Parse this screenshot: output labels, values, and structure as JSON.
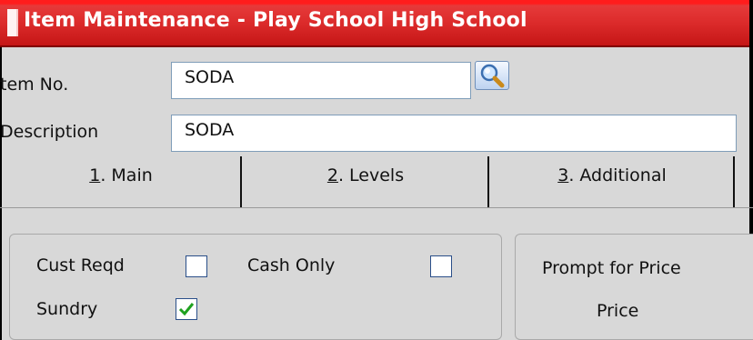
{
  "window": {
    "title": "Item Maintenance - Play School High School"
  },
  "fields": {
    "item_no": {
      "label": "tem No.",
      "value": "SODA"
    },
    "description": {
      "label": "Description",
      "value": "SODA"
    }
  },
  "icons": {
    "app": "app-icon",
    "search": "magnifier-icon",
    "checkmark": "check-icon"
  },
  "tabs": [
    {
      "mnemonic": "1",
      "label": ". Main",
      "active": true
    },
    {
      "mnemonic": "2",
      "label": ". Levels",
      "active": false
    },
    {
      "mnemonic": "3",
      "label": ". Additional",
      "active": false
    }
  ],
  "main_panel": {
    "cust_reqd": {
      "label": "Cust Reqd",
      "checked": false
    },
    "cash_only": {
      "label": "Cash Only",
      "checked": false
    },
    "sundry": {
      "label": "Sundry",
      "checked": true
    }
  },
  "price_panel": {
    "prompt_label": "Prompt for Price",
    "price_label": "Price"
  },
  "colors": {
    "title_bar": "#dc2b2b",
    "window_bg": "#d8d8d8",
    "check_green": "#1fa11f",
    "field_border": "#7f9db9"
  }
}
